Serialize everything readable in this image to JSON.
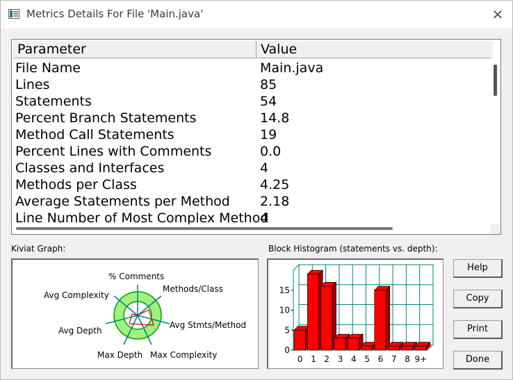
{
  "window": {
    "title": "Metrics Details For File 'Main.java'",
    "close_symbol": "✕"
  },
  "table": {
    "headers": [
      "Parameter",
      "Value"
    ],
    "rows": [
      {
        "parameter": "File Name",
        "value": "Main.java"
      },
      {
        "parameter": "Lines",
        "value": "85"
      },
      {
        "parameter": "Statements",
        "value": "54"
      },
      {
        "parameter": "Percent Branch Statements",
        "value": "14.8"
      },
      {
        "parameter": "Method Call Statements",
        "value": "19"
      },
      {
        "parameter": "Percent Lines with Comments",
        "value": "0.0"
      },
      {
        "parameter": "Classes and Interfaces",
        "value": "4"
      },
      {
        "parameter": "Methods per Class",
        "value": "4.25"
      },
      {
        "parameter": "Average Statements per Method",
        "value": "2.18"
      },
      {
        "parameter": "Line Number of Most Complex Method",
        "value": "4"
      }
    ]
  },
  "kiviat": {
    "label": "Kiviat Graph:",
    "axes": [
      "% Comments",
      "Methods/Class",
      "Avg Stmts/Method",
      "Max Complexity",
      "Max Depth",
      "Avg Depth",
      "Avg Complexity"
    ],
    "colors": {
      "ring": "#00a000",
      "band": "#a0f080",
      "axis": "#008080",
      "line": "#d00000"
    }
  },
  "histogram": {
    "label": "Block Histogram (statements vs. depth):",
    "colors": {
      "bar": "#ff0000",
      "bar_side": "#a00000",
      "grid": "#008080",
      "floor": "#c0c0c0"
    }
  },
  "chart_data": {
    "type": "bar",
    "categories": [
      "0",
      "1",
      "2",
      "3",
      "4",
      "5",
      "6",
      "7",
      "8",
      "9+"
    ],
    "values": [
      5,
      19,
      16,
      3,
      3,
      1,
      15,
      1,
      1,
      1
    ],
    "yticks": [
      0,
      5,
      10,
      15
    ],
    "ylim": [
      0,
      20
    ],
    "title": "",
    "xlabel": "",
    "ylabel": "",
    "grid": true,
    "style": "3d-bars"
  },
  "buttons": {
    "help": "Help",
    "copy": "Copy",
    "print": "Print",
    "done": "Done"
  }
}
